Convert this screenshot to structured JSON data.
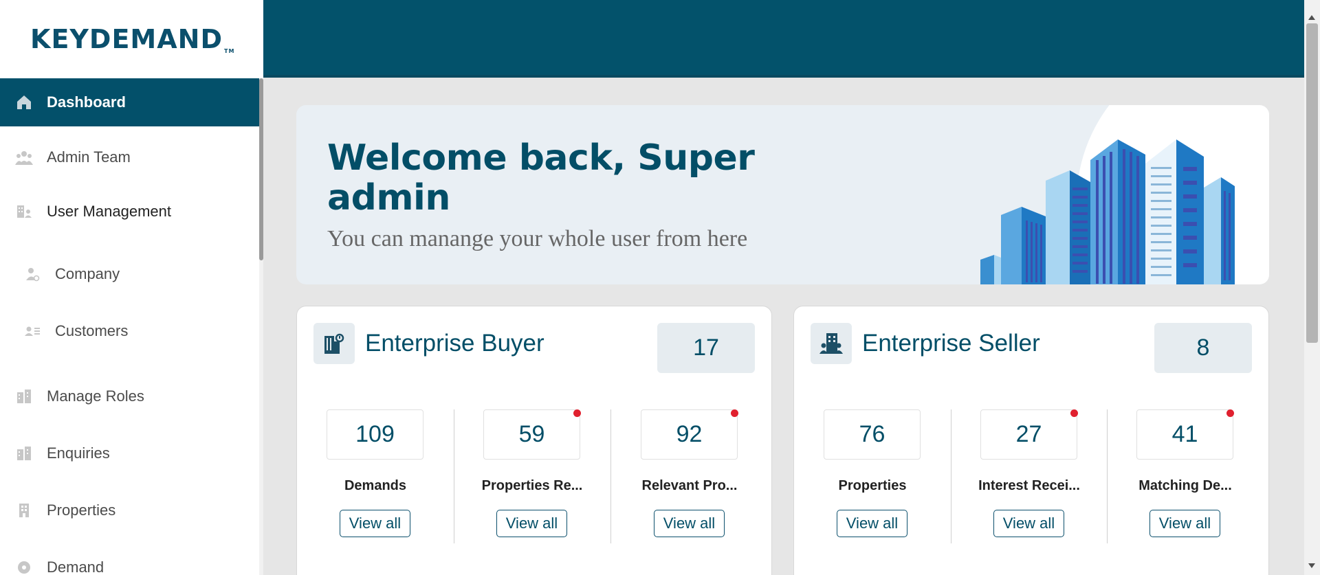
{
  "brand": {
    "logo_text": "KEYDEMAND",
    "logo_tm": "TM",
    "accent": "#03506a",
    "logo_key_color": "#e8a33a"
  },
  "sidebar": {
    "items": [
      {
        "label": "Dashboard",
        "icon": "home-icon",
        "active": true
      },
      {
        "label": "Admin Team",
        "icon": "team-icon"
      },
      {
        "label": "User Management",
        "icon": "user-management-icon"
      },
      {
        "label": "Company",
        "icon": "company-icon"
      },
      {
        "label": "Customers",
        "icon": "customers-icon"
      },
      {
        "label": "Manage Roles",
        "icon": "roles-icon"
      },
      {
        "label": "Enquiries",
        "icon": "enquiries-icon"
      },
      {
        "label": "Properties",
        "icon": "properties-icon"
      },
      {
        "label": "Demand",
        "icon": "demand-icon"
      }
    ]
  },
  "welcome": {
    "title": "Welcome back, Super admin",
    "subtitle": "You can manange your whole user from here"
  },
  "buyer": {
    "title": "Enterprise Buyer",
    "count": "17",
    "icon": "buyer-building-icon",
    "stats": [
      {
        "value": "109",
        "label": "Demands",
        "button": "View all",
        "notify": false
      },
      {
        "value": "59",
        "label": "Properties Re...",
        "button": "View all",
        "notify": true
      },
      {
        "value": "92",
        "label": "Relevant Pro...",
        "button": "View all",
        "notify": true
      }
    ]
  },
  "seller": {
    "title": "Enterprise Seller",
    "count": "8",
    "icon": "seller-building-icon",
    "stats": [
      {
        "value": "76",
        "label": "Properties",
        "button": "View all",
        "notify": false
      },
      {
        "value": "27",
        "label": "Interest Recei...",
        "button": "View all",
        "notify": true
      },
      {
        "value": "41",
        "label": "Matching De...",
        "button": "View all",
        "notify": true
      }
    ]
  }
}
